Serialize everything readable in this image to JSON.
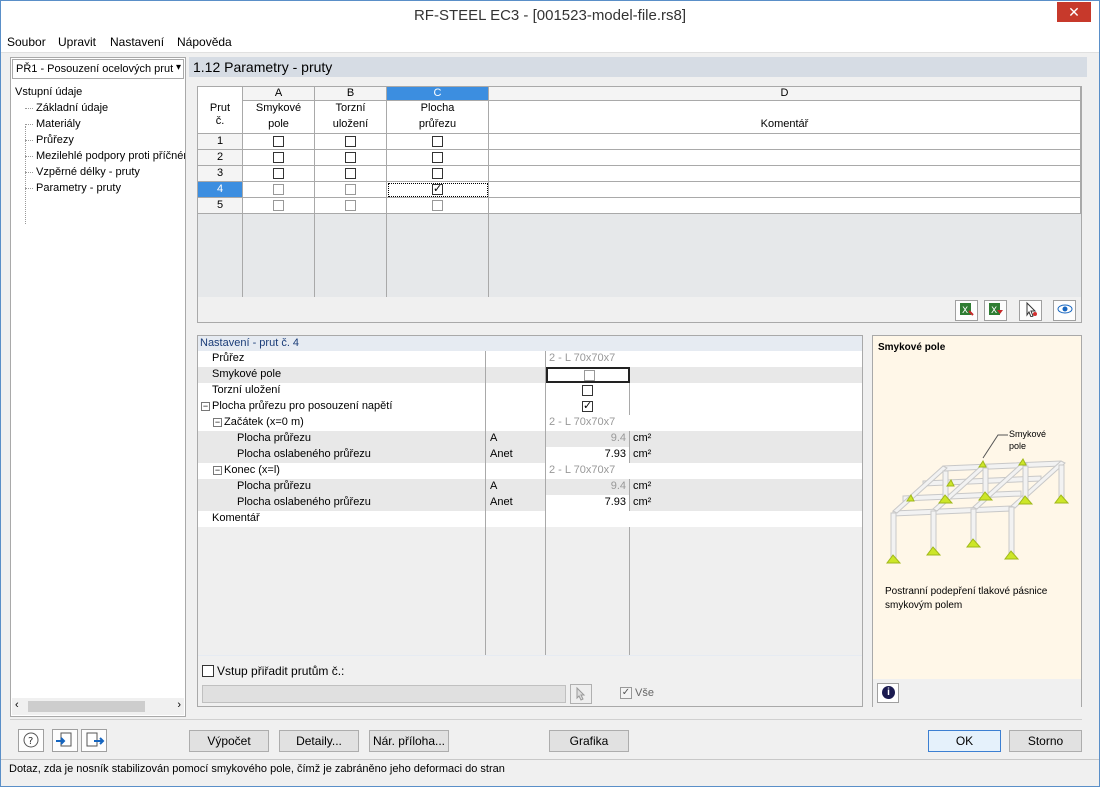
{
  "window": {
    "title": "RF-STEEL EC3 - [001523-model-file.rs8]",
    "close": "✕"
  },
  "menu": [
    "Soubor",
    "Upravit",
    "Nastavení",
    "Nápověda"
  ],
  "left": {
    "combo": "PŘ1 - Posouzení ocelových prut",
    "root": "Vstupní údaje",
    "items": [
      "Základní údaje",
      "Materiály",
      "Průřezy",
      "Mezilehlé podpory proti příčném",
      "Vzpěrné délky - pruty",
      "Parametry - pruty"
    ]
  },
  "header": "1.12 Parametry - pruty",
  "grid": {
    "letters": [
      "A",
      "B",
      "C",
      "D"
    ],
    "rowhead": [
      "Prut",
      "č."
    ],
    "cols": [
      {
        "l1": "Smykové",
        "l2": "pole"
      },
      {
        "l1": "Torzní",
        "l2": "uložení"
      },
      {
        "l1": "Plocha",
        "l2": "průřezu"
      },
      {
        "l1": "",
        "l2": "Komentář"
      }
    ],
    "rows": [
      {
        "num": "1",
        "a": false,
        "b": false,
        "c": false
      },
      {
        "num": "2",
        "a": false,
        "b": false,
        "c": false
      },
      {
        "num": "3",
        "a": false,
        "b": false,
        "c": false
      },
      {
        "num": "4",
        "a": false,
        "b": false,
        "c": true
      },
      {
        "num": "5",
        "a": false,
        "b": false,
        "c": false
      }
    ],
    "selected_row": "4",
    "selected_col": "C"
  },
  "settings": {
    "caption": "Nastavení - prut č. 4",
    "rows": {
      "prurez": "Průřez",
      "prurez_val": "2 - L 70x70x7",
      "smyk": "Smykové pole",
      "torz": "Torzní uložení",
      "plocha": "Plocha průřezu pro posouzení napětí",
      "zac": "Začátek (x=0 m)",
      "zac_val": "2 - L 70x70x7",
      "pp1": "Plocha průřezu",
      "pp1_sym": "A",
      "pp1_val": "9.4",
      "po1": "Plocha oslabeného průřezu",
      "po1_sym": "Anet",
      "po1_val": "7.93",
      "kon": "Konec (x=l)",
      "kon_val": "2 - L 70x70x7",
      "pp2": "Plocha průřezu",
      "pp2_sym": "A",
      "pp2_val": "9.4",
      "po2": "Plocha oslabeného průřezu",
      "po2_sym": "Anet",
      "po2_val": "7.93",
      "unit": "cm²",
      "kom": "Komentář"
    },
    "assign_label": "Vstup přiřadit prutům č.:",
    "all_label": "Vše"
  },
  "info": {
    "title": "Smykové pole",
    "callout_1": "Smykové",
    "callout_2": "pole",
    "desc_1": "Postranní podepření tlakové pásnice",
    "desc_2": "smykovým polem"
  },
  "buttons": {
    "calc": "Výpočet",
    "details": "Detaily...",
    "annex": "Nár. příloha...",
    "graphics": "Grafika",
    "ok": "OK",
    "cancel": "Storno"
  },
  "status": "Dotaz, zda je nosník stabilizován pomocí smykového pole, čímž je zabráněno jeho deformaci do stran"
}
